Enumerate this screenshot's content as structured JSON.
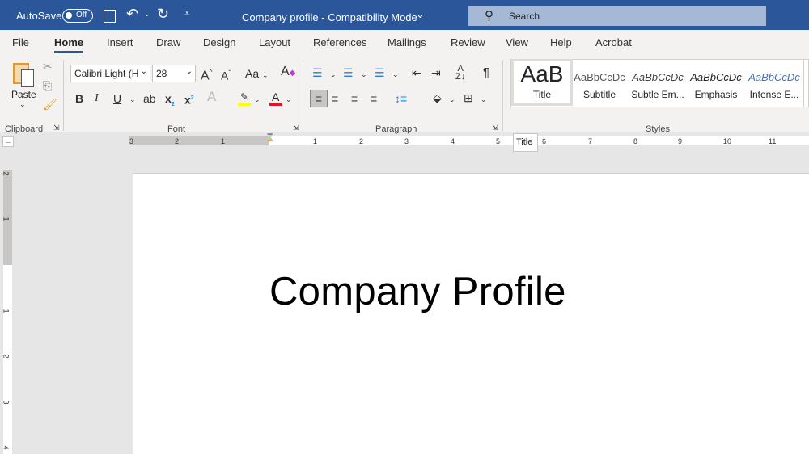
{
  "titlebar": {
    "autosave_label": "AutoSave",
    "autosave_state": "Off",
    "doc_title": "Company profile  -  Compatibility Mode",
    "search_placeholder": "Search"
  },
  "tabs": [
    "File",
    "Home",
    "Insert",
    "Draw",
    "Design",
    "Layout",
    "References",
    "Mailings",
    "Review",
    "View",
    "Help",
    "Acrobat"
  ],
  "active_tab": "Home",
  "ribbon": {
    "clipboard": {
      "paste_label": "Paste",
      "group_label": "Clipboard"
    },
    "font": {
      "font_name": "Calibri Light (H",
      "font_size": "28",
      "change_case": "Aa",
      "group_label": "Font",
      "bold": "B",
      "italic": "I",
      "underline": "U",
      "strike": "ab",
      "sub": "x",
      "sup": "x",
      "highlight_color": "#ffff00",
      "font_color": "#e81123"
    },
    "paragraph": {
      "group_label": "Paragraph"
    },
    "styles": {
      "group_label": "Styles",
      "items": [
        {
          "preview": "AaB",
          "label": "Title"
        },
        {
          "preview": "AaBbCcDc",
          "label": "Subtitle"
        },
        {
          "preview": "AaBbCcDc",
          "label": "Subtle Em..."
        },
        {
          "preview": "AaBbCcDc",
          "label": "Emphasis"
        },
        {
          "preview": "AaBbCcDc",
          "label": "Intense E..."
        }
      ]
    }
  },
  "ruler": {
    "left_numbers": [
      "3",
      "2",
      "1"
    ],
    "right_numbers": [
      "1",
      "2",
      "3",
      "4",
      "5",
      "6",
      "7",
      "8",
      "9",
      "10",
      "11"
    ],
    "tooltip": "Title",
    "vertical_numbers": [
      "2",
      "1",
      "1",
      "2",
      "3",
      "4"
    ]
  },
  "document": {
    "title_text": "Company Profile"
  },
  "colors": {
    "brand": "#2b579a",
    "intense_emphasis": "#4472c4"
  }
}
